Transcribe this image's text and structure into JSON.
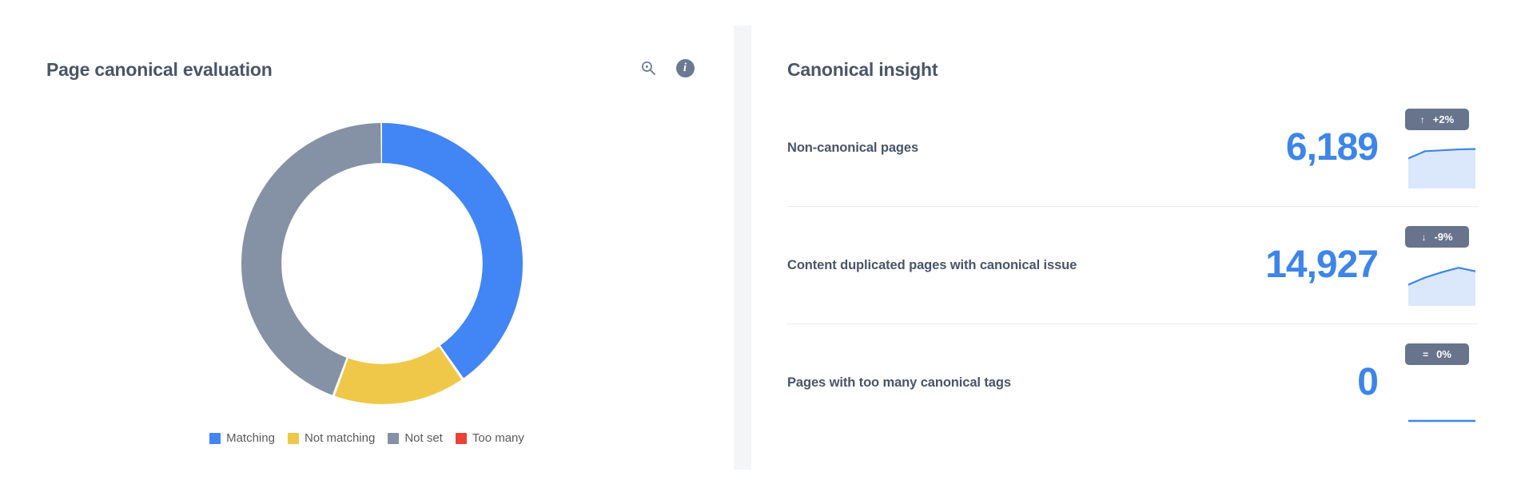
{
  "left_panel": {
    "title": "Page canonical evaluation",
    "magnify_icon": "zoom-in-magnifier-icon",
    "info_icon": "info-icon",
    "legend": [
      {
        "label": "Matching",
        "color": "#4285f4"
      },
      {
        "label": "Not matching",
        "color": "#efc84a"
      },
      {
        "label": "Not set",
        "color": "#8592a5"
      },
      {
        "label": "Too many",
        "color": "#ea4335"
      }
    ]
  },
  "right_panel": {
    "title": "Canonical insight",
    "info_icon": "info-icon",
    "metrics": [
      {
        "label": "Non-canonical pages",
        "value": "6,189",
        "trend_arrow": "↑",
        "trend_text": "+2%",
        "trend_direction": "up"
      },
      {
        "label": "Content duplicated pages with canonical issue",
        "value": "14,927",
        "trend_arrow": "↓",
        "trend_text": "-9%",
        "trend_direction": "down"
      },
      {
        "label": "Pages with too many canonical tags",
        "value": "0",
        "trend_arrow": "=",
        "trend_text": "0%",
        "trend_direction": "flat"
      }
    ]
  },
  "chart_data": [
    {
      "type": "pie",
      "subtype": "donut",
      "title": "Page canonical evaluation",
      "labels": [
        "Matching",
        "Not matching",
        "Not set",
        "Too many"
      ],
      "values": [
        40.3,
        15.3,
        44.4,
        0
      ],
      "unit": "percent",
      "colors": [
        "#4285f4",
        "#efc84a",
        "#8592a5",
        "#ea4335"
      ],
      "start_angle_deg": 0,
      "direction": "clockwise",
      "inner_radius_ratio": 0.715,
      "legend": "bottom",
      "grid": false
    },
    {
      "type": "area",
      "title": "Non-canonical pages sparkline",
      "x": [
        0,
        1,
        2,
        3,
        4
      ],
      "values": [
        0.62,
        0.78,
        0.8,
        0.82,
        0.83
      ],
      "ylim": [
        0,
        1
      ],
      "line_color": "#3d85e8",
      "fill_color": "#dbe8fb",
      "grid": false
    },
    {
      "type": "area",
      "title": "Content duplicated pages with canonical issue sparkline",
      "x": [
        0,
        1,
        2,
        3,
        4
      ],
      "values": [
        0.42,
        0.58,
        0.7,
        0.8,
        0.72
      ],
      "ylim": [
        0,
        1
      ],
      "line_color": "#3d85e8",
      "fill_color": "#dbe8fb",
      "grid": false
    },
    {
      "type": "line",
      "title": "Pages with too many canonical tags sparkline",
      "x": [
        0,
        1,
        2,
        3,
        4
      ],
      "values": [
        0,
        0,
        0,
        0,
        0
      ],
      "ylim": [
        0,
        1
      ],
      "line_color": "#3d85e8",
      "grid": false
    }
  ]
}
